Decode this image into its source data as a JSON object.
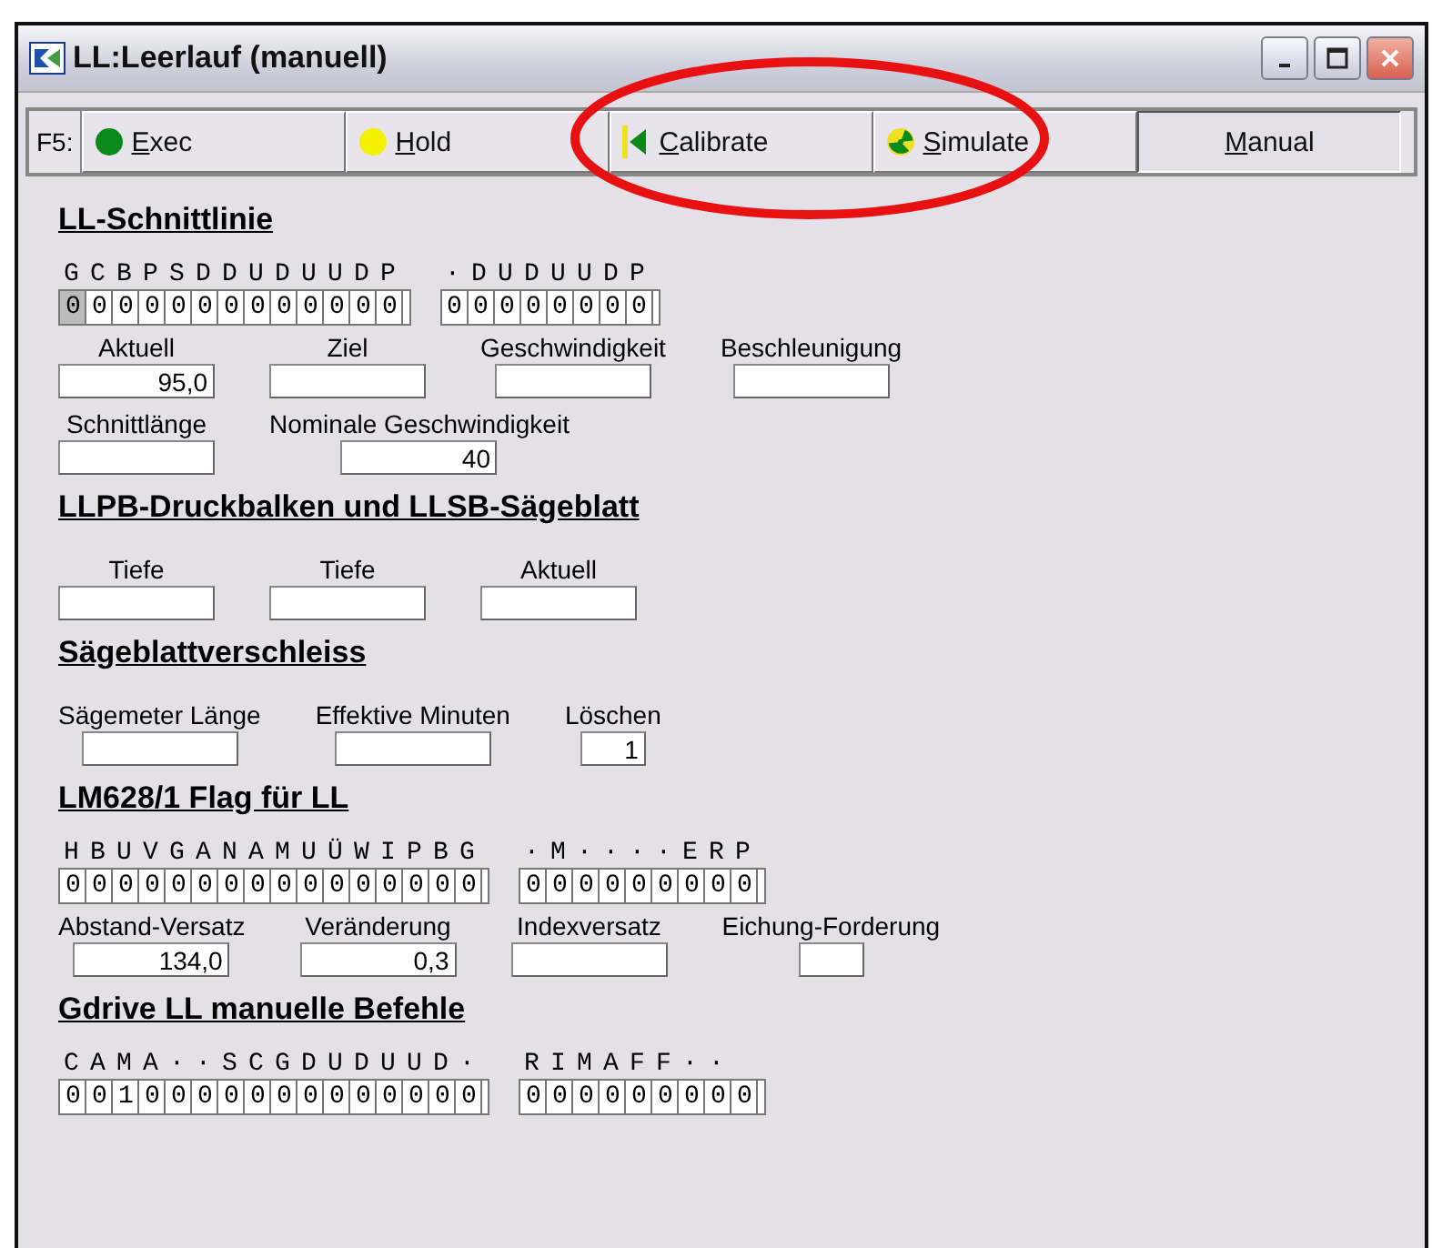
{
  "window": {
    "title": "LL:Leerlauf (manuell)"
  },
  "toolbar": {
    "label": "F5:",
    "buttons": [
      {
        "label": "Exec",
        "kind": "exec",
        "selected": false
      },
      {
        "label": "Hold",
        "kind": "hold",
        "selected": false
      },
      {
        "label": "Calibrate",
        "kind": "calibrate",
        "selected": false
      },
      {
        "label": "Simulate",
        "kind": "simulate",
        "selected": false
      },
      {
        "label": "Manual",
        "kind": "manual",
        "selected": true
      }
    ]
  },
  "sections": [
    {
      "title": "LL-Schnittlinie",
      "rows": [
        {
          "kind": "bits",
          "groups": [
            {
              "header": "GCBPSDDUDUUDP",
              "values": "0000000000000",
              "focused_first": true
            },
            {
              "header": "·DUDUUDP",
              "values": "00000000",
              "focused_first": false
            }
          ]
        },
        {
          "kind": "fields",
          "fields": [
            {
              "label": "Aktuell",
              "value": "95,0",
              "kind": "wide"
            },
            {
              "label": "Ziel",
              "kind": "wide"
            },
            {
              "label": "Geschwindigkeit",
              "kind": "wide"
            },
            {
              "label": "Beschleunigung",
              "kind": "wide"
            }
          ]
        },
        {
          "kind": "fields",
          "fields": [
            {
              "label": "Schnittlänge",
              "kind": "wide"
            },
            {
              "label": "Nominale Geschwindigkeit",
              "value": "40",
              "kind": "wide"
            }
          ]
        }
      ]
    },
    {
      "title": "LLPB-Druckbalken und LLSB-Sägeblatt",
      "rows": [
        {
          "kind": "fields",
          "fields": [
            {
              "label": "Tiefe",
              "kind": "wide"
            },
            {
              "label": "Tiefe",
              "kind": "wide"
            },
            {
              "label": "Aktuell",
              "kind": "wide"
            }
          ]
        }
      ]
    },
    {
      "title": "Sägeblattverschleiss",
      "rows": [
        {
          "kind": "fields",
          "fields": [
            {
              "label": "Sägemeter Länge",
              "kind": "wide"
            },
            {
              "label": "Effektive Minuten",
              "kind": "wide"
            },
            {
              "label": "Löschen",
              "value": "1",
              "kind": "short"
            }
          ]
        }
      ]
    },
    {
      "title": "LM628/1 Flag für LL",
      "rows": [
        {
          "kind": "bits",
          "groups": [
            {
              "header": "HBUVGANAMUÜWIPBG",
              "values": "0000000000000000",
              "focused_first": false
            },
            {
              "header": "·M····ERP",
              "values": "000000000",
              "focused_first": false
            }
          ]
        },
        {
          "kind": "fields",
          "fields": [
            {
              "label": "Abstand-Versatz",
              "value": "134,0",
              "kind": "wide"
            },
            {
              "label": "Veränderung",
              "value": "0,3",
              "kind": "wide"
            },
            {
              "label": "Indexversatz",
              "kind": "wide"
            },
            {
              "label": "Eichung-Forderung",
              "kind": "short"
            }
          ]
        }
      ]
    },
    {
      "title": "Gdrive LL manuelle Befehle",
      "rows": [
        {
          "kind": "bits",
          "groups": [
            {
              "header": "CAMA··SCGDUDUUD·",
              "values": "0010000000000000",
              "focused_first": false
            },
            {
              "header": "RIMAFF··",
              "values": "000000000",
              "focused_first": false
            }
          ]
        }
      ]
    }
  ]
}
